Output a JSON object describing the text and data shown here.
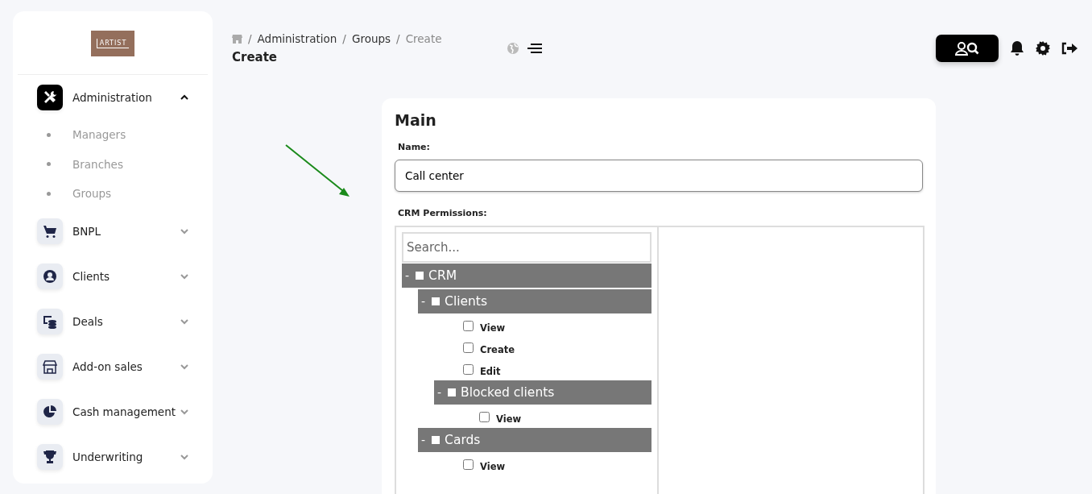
{
  "logo": {
    "text": "ARTIST"
  },
  "sidebar": {
    "items": [
      {
        "label": "Administration",
        "selected": true,
        "expanded": true,
        "children": [
          {
            "label": "Managers"
          },
          {
            "label": "Branches"
          },
          {
            "label": "Groups"
          }
        ]
      },
      {
        "label": "BNPL",
        "selected": false,
        "expanded": false
      },
      {
        "label": "Clients",
        "selected": false,
        "expanded": false
      },
      {
        "label": "Deals",
        "selected": false,
        "expanded": false
      },
      {
        "label": "Add-on sales",
        "selected": false,
        "expanded": false
      },
      {
        "label": "Cash management",
        "selected": false,
        "expanded": false
      },
      {
        "label": "Underwriting",
        "selected": false,
        "expanded": false
      }
    ]
  },
  "breadcrumb": {
    "separator": "/",
    "items": [
      "Administration",
      "Groups",
      "Create"
    ]
  },
  "page_title": "Create",
  "form": {
    "title": "Main",
    "name_label": "Name:",
    "name_value": "Call center",
    "permissions_label": "CRM Permissions:",
    "search": {
      "placeholder": "Search..."
    },
    "tree": [
      {
        "kind": "group",
        "toggle": "-",
        "label": "CRM",
        "children": [
          {
            "kind": "group",
            "toggle": "-",
            "label": "Clients",
            "children": [
              {
                "kind": "permission",
                "label": "View",
                "checked": false
              },
              {
                "kind": "permission",
                "label": "Create",
                "checked": false
              },
              {
                "kind": "permission",
                "label": "Edit",
                "checked": false
              },
              {
                "kind": "group",
                "toggle": "-",
                "label": "Blocked clients",
                "children": [
                  {
                    "kind": "permission",
                    "label": "View",
                    "checked": false
                  }
                ]
              }
            ]
          },
          {
            "kind": "group",
            "toggle": "-",
            "label": "Cards",
            "children": [
              {
                "kind": "permission",
                "label": "View",
                "checked": false
              }
            ]
          }
        ]
      }
    ]
  }
}
